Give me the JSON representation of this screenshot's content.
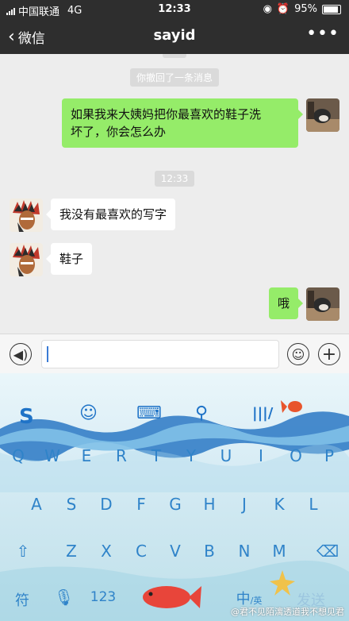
{
  "status_bar": {
    "carrier": "中国联通",
    "network": "4G",
    "time": "12:33",
    "battery": "95%"
  },
  "nav": {
    "back_label": "微信",
    "title": "sayid",
    "more": "•••"
  },
  "chat": {
    "recall_notice": "你撤回了一条消息",
    "timestamp": "12:33",
    "messages": [
      {
        "from": "me",
        "text_line1": "如果我来大姨妈把你最喜欢的鞋子洗",
        "text_line2": "坏了，你会怎么办"
      },
      {
        "from": "other",
        "text": "我没有最喜欢的写字"
      },
      {
        "from": "other",
        "text": "鞋子"
      },
      {
        "from": "me",
        "text": "哦"
      }
    ]
  },
  "keyboard": {
    "row1": [
      "Q",
      "W",
      "E",
      "R",
      "T",
      "Y",
      "U",
      "I",
      "O",
      "P"
    ],
    "row2": [
      "A",
      "S",
      "D",
      "F",
      "G",
      "H",
      "J",
      "K",
      "L"
    ],
    "row3": [
      "Z",
      "X",
      "C",
      "V",
      "B",
      "N",
      "M"
    ],
    "bottom": {
      "symbols": "符",
      "numbers": "123",
      "lang": "中",
      "lang_sub": "/英",
      "send": "发送"
    }
  },
  "watermark": "@君不见陌漓透道我不想见君"
}
